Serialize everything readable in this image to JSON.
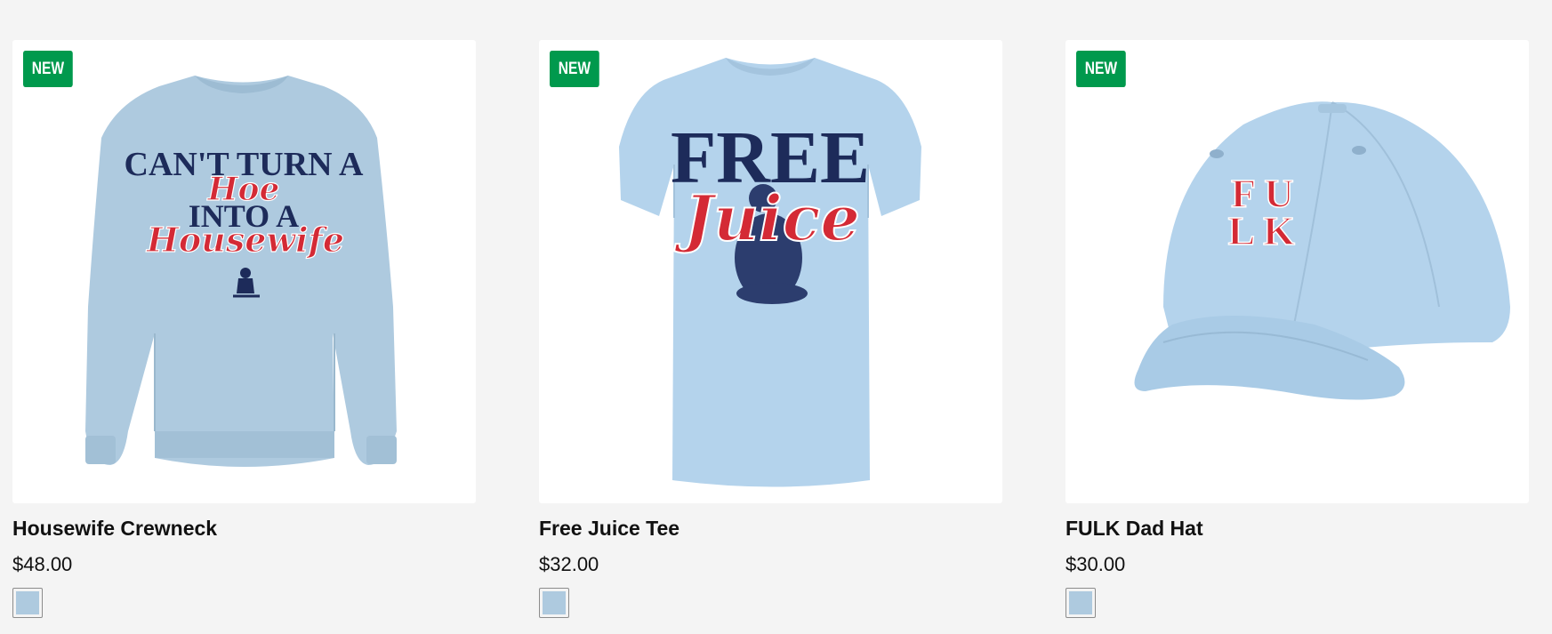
{
  "products": [
    {
      "title": "Housewife Crewneck",
      "price": "$48.00",
      "badge": "NEW",
      "swatch_color": "#aecadf",
      "graphic_text": [
        "CAN'T TURN A",
        "Hoe",
        "INTO A",
        "Housewife"
      ]
    },
    {
      "title": "Free Juice Tee",
      "price": "$32.00",
      "badge": "NEW",
      "swatch_color": "#aecadf",
      "graphic_text": [
        "FREE",
        "Juice"
      ]
    },
    {
      "title": "FULK Dad Hat",
      "price": "$30.00",
      "badge": "NEW",
      "swatch_color": "#aecadf",
      "graphic_text": [
        "F",
        "U",
        "L",
        "K"
      ]
    }
  ],
  "colors": {
    "badge": "#00994d",
    "garment": "#aecadf",
    "navy": "#1d2b5a",
    "red": "#d42a35"
  }
}
